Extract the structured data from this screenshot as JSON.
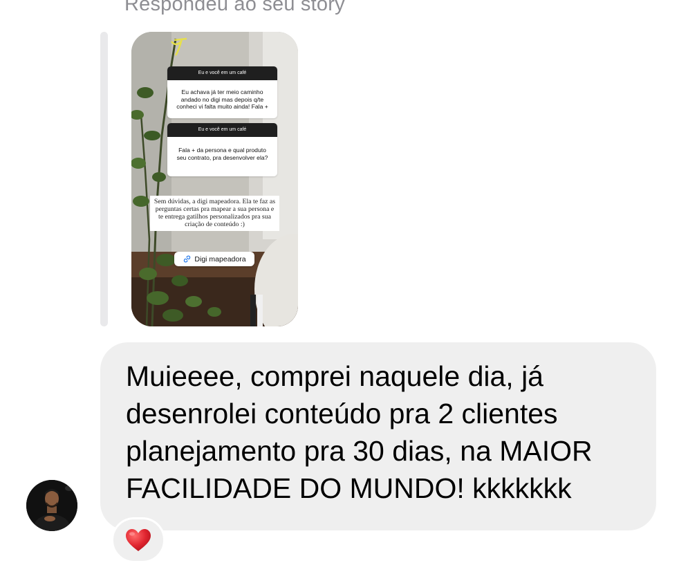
{
  "reply_context": {
    "label": "Respondeu ao seu story"
  },
  "story": {
    "question_cards": [
      {
        "header": "Eu e você em um café",
        "body": "Eu achava já ter meio caminho andado no digi mas depois q/te conheci vi falta muito ainda! Fala +"
      },
      {
        "header": "Eu e você em um café",
        "body": "Fala + da persona e qual produto seu contrato, pra desenvolver ela?"
      }
    ],
    "answer_text": "Sem dúvidas, a digi mapeadora. Ela te faz as perguntas certas pra mapear a sua persona e te entrega gatilhos personalizados pra sua criação de conteúdo :)",
    "link_sticker": {
      "icon": "link-icon",
      "label": "Digi mapeadora"
    }
  },
  "message": {
    "text": "Muieeee, comprei naquele dia, já\ndesenrolei conteúdo pra 2 clientes\nplanejamento pra 30 dias, na MAIOR\nFACILIDADE DO MUNDO! kkkkkkk"
  },
  "reaction": {
    "icon": "red-heart-icon",
    "color": "#e0252f"
  },
  "sender": {
    "avatar_icon": "avatar"
  },
  "colors": {
    "bubble_bg": "#efefef",
    "secondary_text": "#8e8e93",
    "reply_bar": "#e9e9eb"
  }
}
